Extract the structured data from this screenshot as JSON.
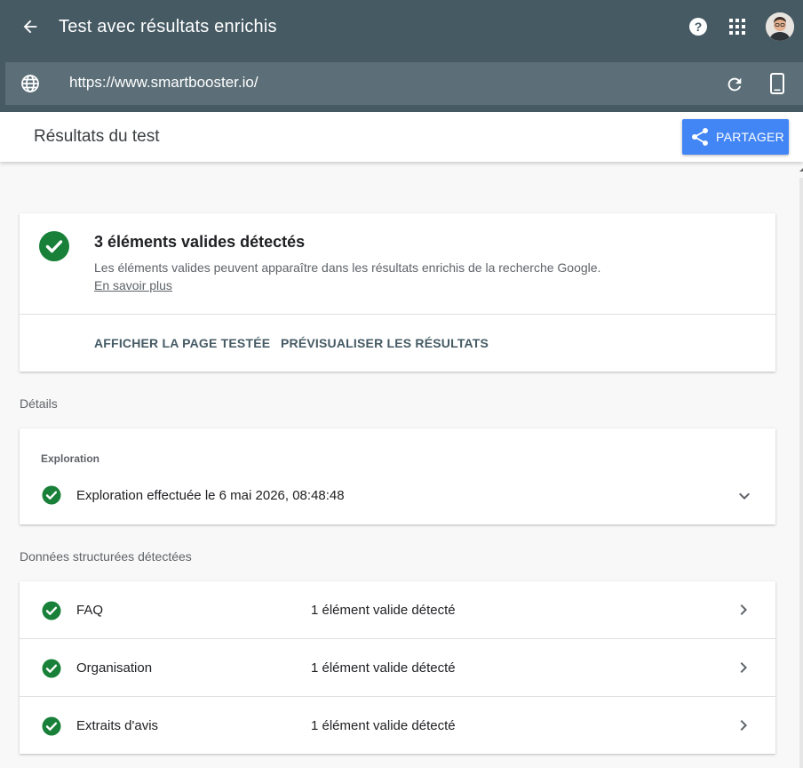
{
  "header": {
    "title": "Test avec résultats enrichis"
  },
  "urlbar": {
    "url": "https://www.smartbooster.io/"
  },
  "subheader": {
    "title": "Résultats du test",
    "share_label": "PARTAGER"
  },
  "summary": {
    "title": "3 éléments valides détectés",
    "description": "Les éléments valides peuvent apparaître dans les résultats enrichis de la recherche Google.",
    "learn_more": "En savoir plus",
    "actions": [
      "AFFICHER LA PAGE TESTÉE",
      "PRÉVISUALISER LES RÉSULTATS"
    ]
  },
  "details": {
    "section_label": "Détails",
    "category": "Exploration",
    "status_text": "Exploration effectuée le 6 mai 2026, 08:48:48"
  },
  "structured": {
    "section_label": "Données structurées détectées",
    "rows": [
      {
        "name": "FAQ",
        "status": "1 élément valide détecté"
      },
      {
        "name": "Organisation",
        "status": "1 élément valide détecté"
      },
      {
        "name": "Extraits d'avis",
        "status": "1 élément valide détecté"
      }
    ]
  },
  "colors": {
    "topbar": "#465a64",
    "urlbar": "#5c6f78",
    "success_green": "#188038",
    "share_blue": "#4285f4"
  },
  "icons": [
    "arrow-back-icon",
    "help-icon",
    "apps-grid-icon",
    "avatar",
    "globe-icon",
    "reload-icon",
    "smartphone-icon",
    "share-icon",
    "check-circle-icon",
    "chevron-down-icon",
    "chevron-right-icon"
  ]
}
